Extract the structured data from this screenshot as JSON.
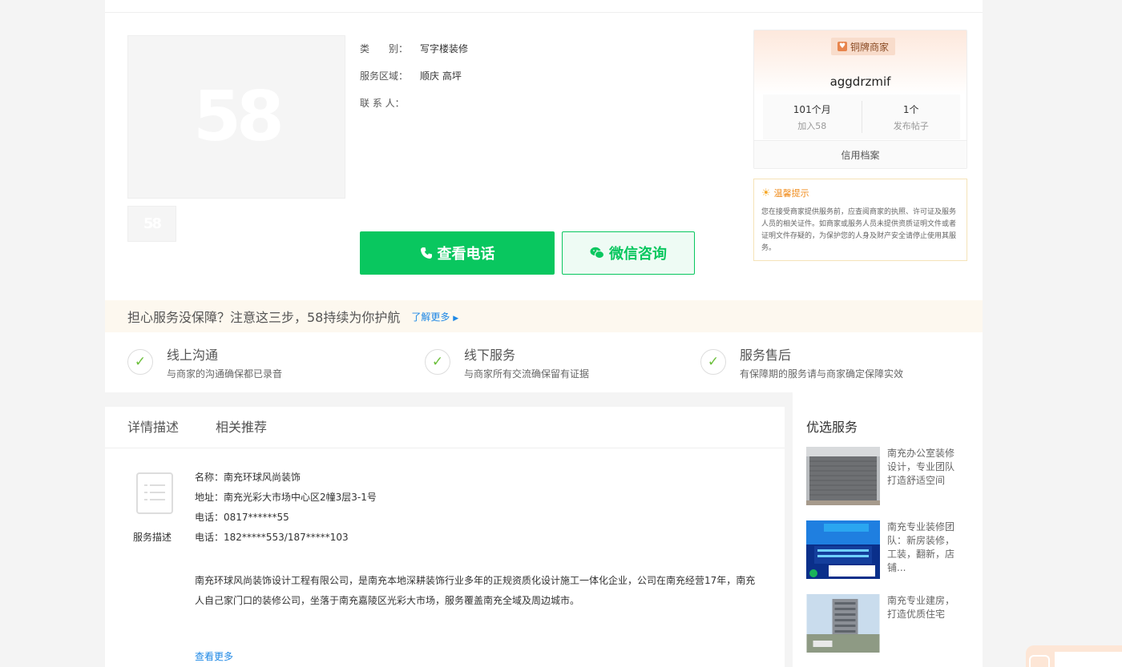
{
  "gallery": {
    "logo_text": "58",
    "thumb_logo_text": "58"
  },
  "info": {
    "rows": [
      {
        "key": "类　　别：",
        "value": "写字楼装修"
      },
      {
        "key": "服务区域：",
        "value": "顺庆  高坪"
      },
      {
        "key": "联 系 人：",
        "value": ""
      }
    ]
  },
  "actions": {
    "phone_label": "查看电话",
    "wechat_label": "微信咨询"
  },
  "merchant": {
    "badge": "铜牌商家",
    "name": "aggdrzmif",
    "stats": [
      {
        "value": "101个月",
        "label": "加入58"
      },
      {
        "value": "1个",
        "label": "发布帖子"
      }
    ],
    "credit_label": "信用档案"
  },
  "tips": {
    "title": "温馨提示",
    "text": "您在接受商家提供服务前，应查阅商家的执照、许可证及服务人员的相关证件。如商家或服务人员未提供资质证明文件或者证明文件存疑的，为保护您的人身及财产安全请停止使用其服务。"
  },
  "guarantee": {
    "title": "担心服务没保障？注意这三步，58持续为你护航",
    "more": "了解更多",
    "steps": [
      {
        "title": "线上沟通",
        "sub": "与商家的沟通确保都已录音"
      },
      {
        "title": "线下服务",
        "sub": "与商家所有交流确保留有证据"
      },
      {
        "title": "服务售后",
        "sub": "有保障期的服务请与商家确定保障实效"
      }
    ]
  },
  "detail": {
    "tabs": [
      "详情描述",
      "相关推荐"
    ],
    "icon_label": "服务描述",
    "lines": [
      "名称：南充环球风尚装饰",
      "地址：南充光彩大市场中心区2幢3层3-1号",
      "电话：0817******55",
      "电话：182*****553/187*****103"
    ],
    "paragraph": "南充环球风尚装饰设计工程有限公司，是南充本地深耕装饰行业多年的正规资质化设计施工一体化企业，公司在南充经营17年，南充人自己家门口的装修公司，坐落于南充嘉陵区光彩大市场，服务覆盖南充全域及周边城市。",
    "more": "查看更多"
  },
  "sidebar": {
    "title": "优选服务",
    "items": [
      {
        "text": "南充办公室装修设计，专业团队打造舒适空间"
      },
      {
        "text": "南充专业装修团队：新房装修，工装，翻新，店铺..."
      },
      {
        "text": "南充专业建房，打造优质住宅"
      }
    ]
  },
  "colors": {
    "green": "#09c75f",
    "link": "#1e88e5",
    "orange": "#f08c1c"
  }
}
